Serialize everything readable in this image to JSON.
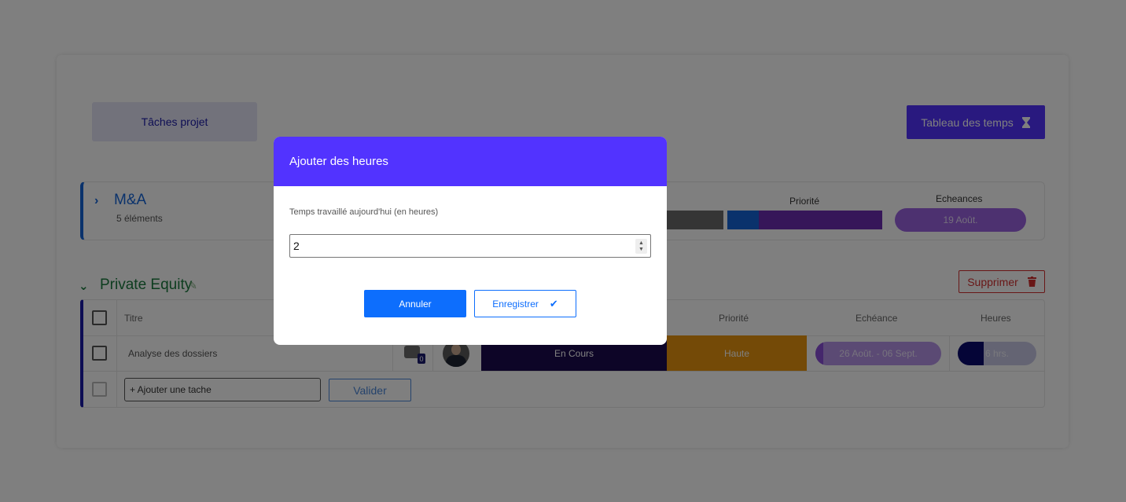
{
  "header": {
    "tab_label": "Tâches projet",
    "timesheet_label": "Tableau des temps",
    "timesheet_icon": "hourglass-icon"
  },
  "group_ma": {
    "title": "M&A",
    "count": "5 éléments",
    "priority_label": "Priorité",
    "deadlines_label": "Echeances",
    "deadline_value": "19 Août."
  },
  "group_pe": {
    "title": "Private Equity",
    "delete_label": "Supprimer",
    "columns": {
      "title": "Titre",
      "priority": "Priorité",
      "deadline": "Echéance",
      "hours": "Heures"
    },
    "rows": [
      {
        "title": "Analyse des dossiers",
        "comments": "0",
        "status": "En Cours",
        "priority": "Haute",
        "deadline": "26 Août. - 06 Sept.",
        "hours": "6 hrs.",
        "hours_progress": 0.33
      }
    ],
    "add_task_placeholder": "+ Ajouter une tache",
    "validate_label": "Valider"
  },
  "modal": {
    "title": "Ajouter des heures",
    "field_label": "Temps travaillé aujourd'hui (en heures)",
    "field_value": "2",
    "cancel_label": "Annuler",
    "save_label": "Enregistrer"
  },
  "colors": {
    "accent": "#5233ff",
    "primary_button": "#0d6efd",
    "status_en_cours": "#1a0a4f",
    "priority_haute": "#e8940f",
    "danger": "#d32f2f"
  }
}
